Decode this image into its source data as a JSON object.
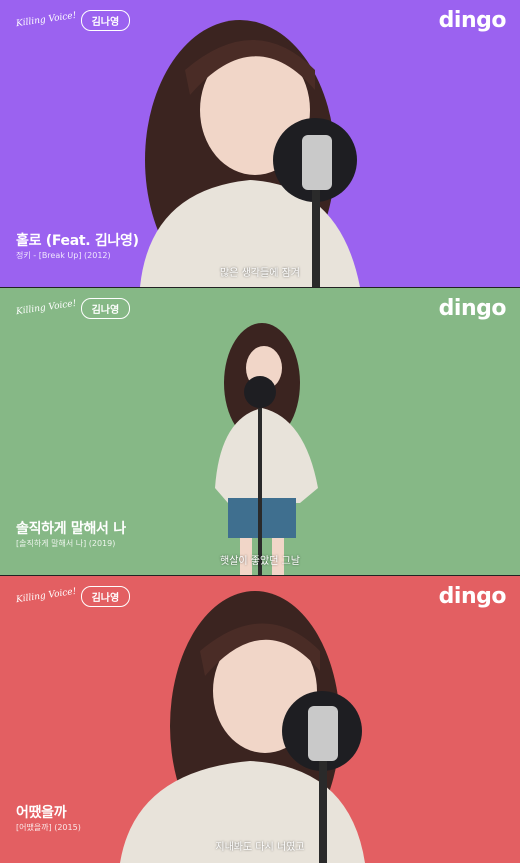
{
  "colors": {
    "panel1_bg": "#9b62f0",
    "panel2_bg": "#86b886",
    "panel3_bg": "#e35f62"
  },
  "panels": [
    {
      "badge_script": "Killing Voice!",
      "badge_label": "김나영",
      "logo": "dingo",
      "song_title": "홀로 (Feat. 김나영)",
      "song_sub": "정키 - [Break Up] (2012)",
      "caption": "많은 생각들에 잠겨"
    },
    {
      "badge_script": "Killing Voice!",
      "badge_label": "김나영",
      "logo": "dingo",
      "song_title": "솔직하게 말해서 나",
      "song_sub": "[솔직하게 말해서 나] (2019)",
      "caption": "햇살이 좋았던 그날"
    },
    {
      "badge_script": "Killing Voice!",
      "badge_label": "김나영",
      "logo": "dingo",
      "song_title": "어땠을까",
      "song_sub": "[어땠을까] (2015)",
      "caption": "지내봐도 다시 너였고"
    }
  ]
}
